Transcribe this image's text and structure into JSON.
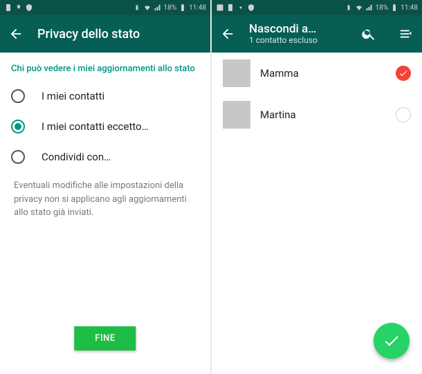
{
  "statusbar": {
    "battery_pct": "18%",
    "time": "11:48"
  },
  "left_screen": {
    "appbar": {
      "title": "Privacy dello stato"
    },
    "section_header": "Chi può vedere i miei aggiornamenti allo stato",
    "options": [
      {
        "label": "I miei contatti",
        "selected": false
      },
      {
        "label": "I miei contatti eccetto…",
        "selected": true
      },
      {
        "label": "Condividi con…",
        "selected": false
      }
    ],
    "hint": "Eventuali modifiche alle impostazioni della privacy non si applicano agli aggiornamenti allo stato già inviati.",
    "done_label": "FINE"
  },
  "right_screen": {
    "appbar": {
      "title": "Nascondi a…",
      "subtitle": "1 contatto escluso"
    },
    "contacts": [
      {
        "name": "Mamma",
        "selected": true
      },
      {
        "name": "Martina",
        "selected": false
      }
    ]
  }
}
